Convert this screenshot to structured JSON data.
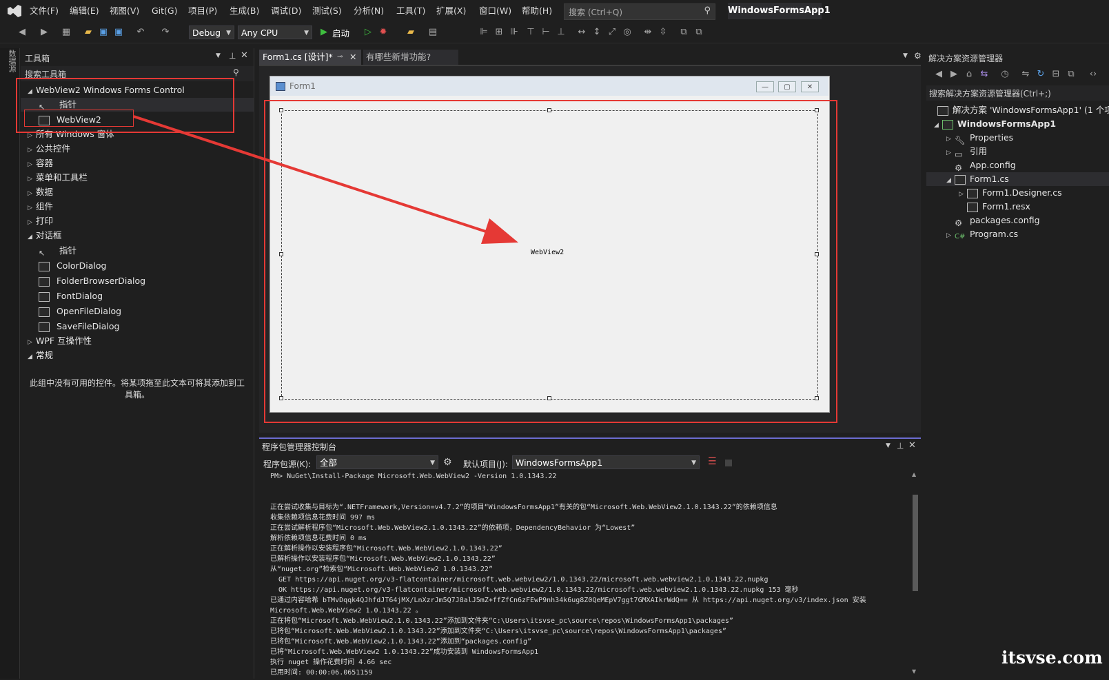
{
  "menubar": {
    "items": [
      "文件(F)",
      "编辑(E)",
      "视图(V)",
      "Git(G)",
      "项目(P)",
      "生成(B)",
      "调试(D)",
      "测试(S)",
      "分析(N)",
      "工具(T)",
      "扩展(X)",
      "窗口(W)",
      "帮助(H)"
    ],
    "search_placeholder": "搜索 (Ctrl+Q)",
    "app_name": "WindowsFormsApp1"
  },
  "toolbar": {
    "config": "Debug",
    "platform": "Any CPU",
    "start_label": "启动"
  },
  "sidestrip": {
    "label": "数据源"
  },
  "toolbox": {
    "title": "工具箱",
    "search_placeholder": "搜索工具箱",
    "group_webview": "WebView2 Windows Forms Control",
    "pointer": "指针",
    "webview2": "WebView2",
    "groups": [
      "所有 Windows 窗体",
      "公共控件",
      "容器",
      "菜单和工具栏",
      "数据",
      "组件",
      "打印"
    ],
    "dialogs_group": "对话框",
    "dialog_items": [
      "指针",
      "ColorDialog",
      "FolderBrowserDialog",
      "FontDialog",
      "OpenFileDialog",
      "SaveFileDialog"
    ],
    "wpf_group": "WPF 互操作性",
    "general_group": "常规",
    "empty_msg_1": "此组中没有可用的控件。将某项拖至此文本可将其添加到工",
    "empty_msg_2": "具箱。"
  },
  "designer": {
    "tab_active": "Form1.cs [设计]*",
    "tab_inactive": "有哪些新增功能?",
    "form_title": "Form1",
    "control_label": "WebView2"
  },
  "console": {
    "title": "程序包管理器控制台",
    "source_label": "程序包源(K):",
    "source_value": "全部",
    "default_project_label": "默认项目(J):",
    "default_project_value": "WindowsFormsApp1",
    "lines": [
      "PM> NuGet\\Install-Package Microsoft.Web.WebView2 -Version 1.0.1343.22",
      "",
      "",
      "正在尝试收集与目标为“.NETFramework,Version=v4.7.2”的项目“WindowsFormsApp1”有关的包“Microsoft.Web.WebView2.1.0.1343.22”的依赖项信息",
      "收集依赖项信息花费时间 997 ms",
      "正在尝试解析程序包“Microsoft.Web.WebView2.1.0.1343.22”的依赖项，DependencyBehavior 为“Lowest”",
      "解析依赖项信息花费时间 0 ms",
      "正在解析操作以安装程序包“Microsoft.Web.WebView2.1.0.1343.22”",
      "已解析操作以安装程序包“Microsoft.Web.WebView2.1.0.1343.22”",
      "从“nuget.org”检索包“Microsoft.Web.WebView2 1.0.1343.22”",
      "  GET https://api.nuget.org/v3-flatcontainer/microsoft.web.webview2/1.0.1343.22/microsoft.web.webview2.1.0.1343.22.nupkg",
      "  OK https://api.nuget.org/v3-flatcontainer/microsoft.web.webview2/1.0.1343.22/microsoft.web.webview2.1.0.1343.22.nupkg 153 毫秒",
      "已通过内容哈希 bTMvDqqk4QJhfdJT64jMX/LnXzrJm5Q7J8alJ5mZ+ffZfCn6zFEwP9nh34k6ug8Z0QeMEpV7ggt7GMXAIkrWdQ== 从 https://api.nuget.org/v3/index.json 安装",
      "Microsoft.Web.WebView2 1.0.1343.22 。",
      "正在将包“Microsoft.Web.WebView2.1.0.1343.22”添加到文件夹“C:\\Users\\itsvse_pc\\source\\repos\\WindowsFormsApp1\\packages”",
      "已将包“Microsoft.Web.WebView2.1.0.1343.22”添加到文件夹“C:\\Users\\itsvse_pc\\source\\repos\\WindowsFormsApp1\\packages”",
      "已将包“Microsoft.Web.WebView2.1.0.1343.22”添加到“packages.config”",
      "已将“Microsoft.Web.WebView2 1.0.1343.22”成功安装到 WindowsFormsApp1",
      "执行 nuget 操作花费时间 4.66 sec",
      "已用时间: 00:00:06.0651159"
    ]
  },
  "solution": {
    "title": "解决方案资源管理器",
    "search_placeholder": "搜索解决方案资源管理器(Ctrl+;)",
    "solution_label": "解决方案 'WindowsFormsApp1' (1 个项目",
    "project": "WindowsFormsApp1",
    "items": [
      "Properties",
      "引用",
      "App.config",
      "Form1.cs",
      "Form1.Designer.cs",
      "Form1.resx",
      "packages.config",
      "Program.cs"
    ]
  },
  "watermark": "itsvse.com",
  "colors": {
    "accent_red": "#e53935",
    "vs_purple": "#6c6cd0",
    "bg": "#1f1f1f"
  }
}
